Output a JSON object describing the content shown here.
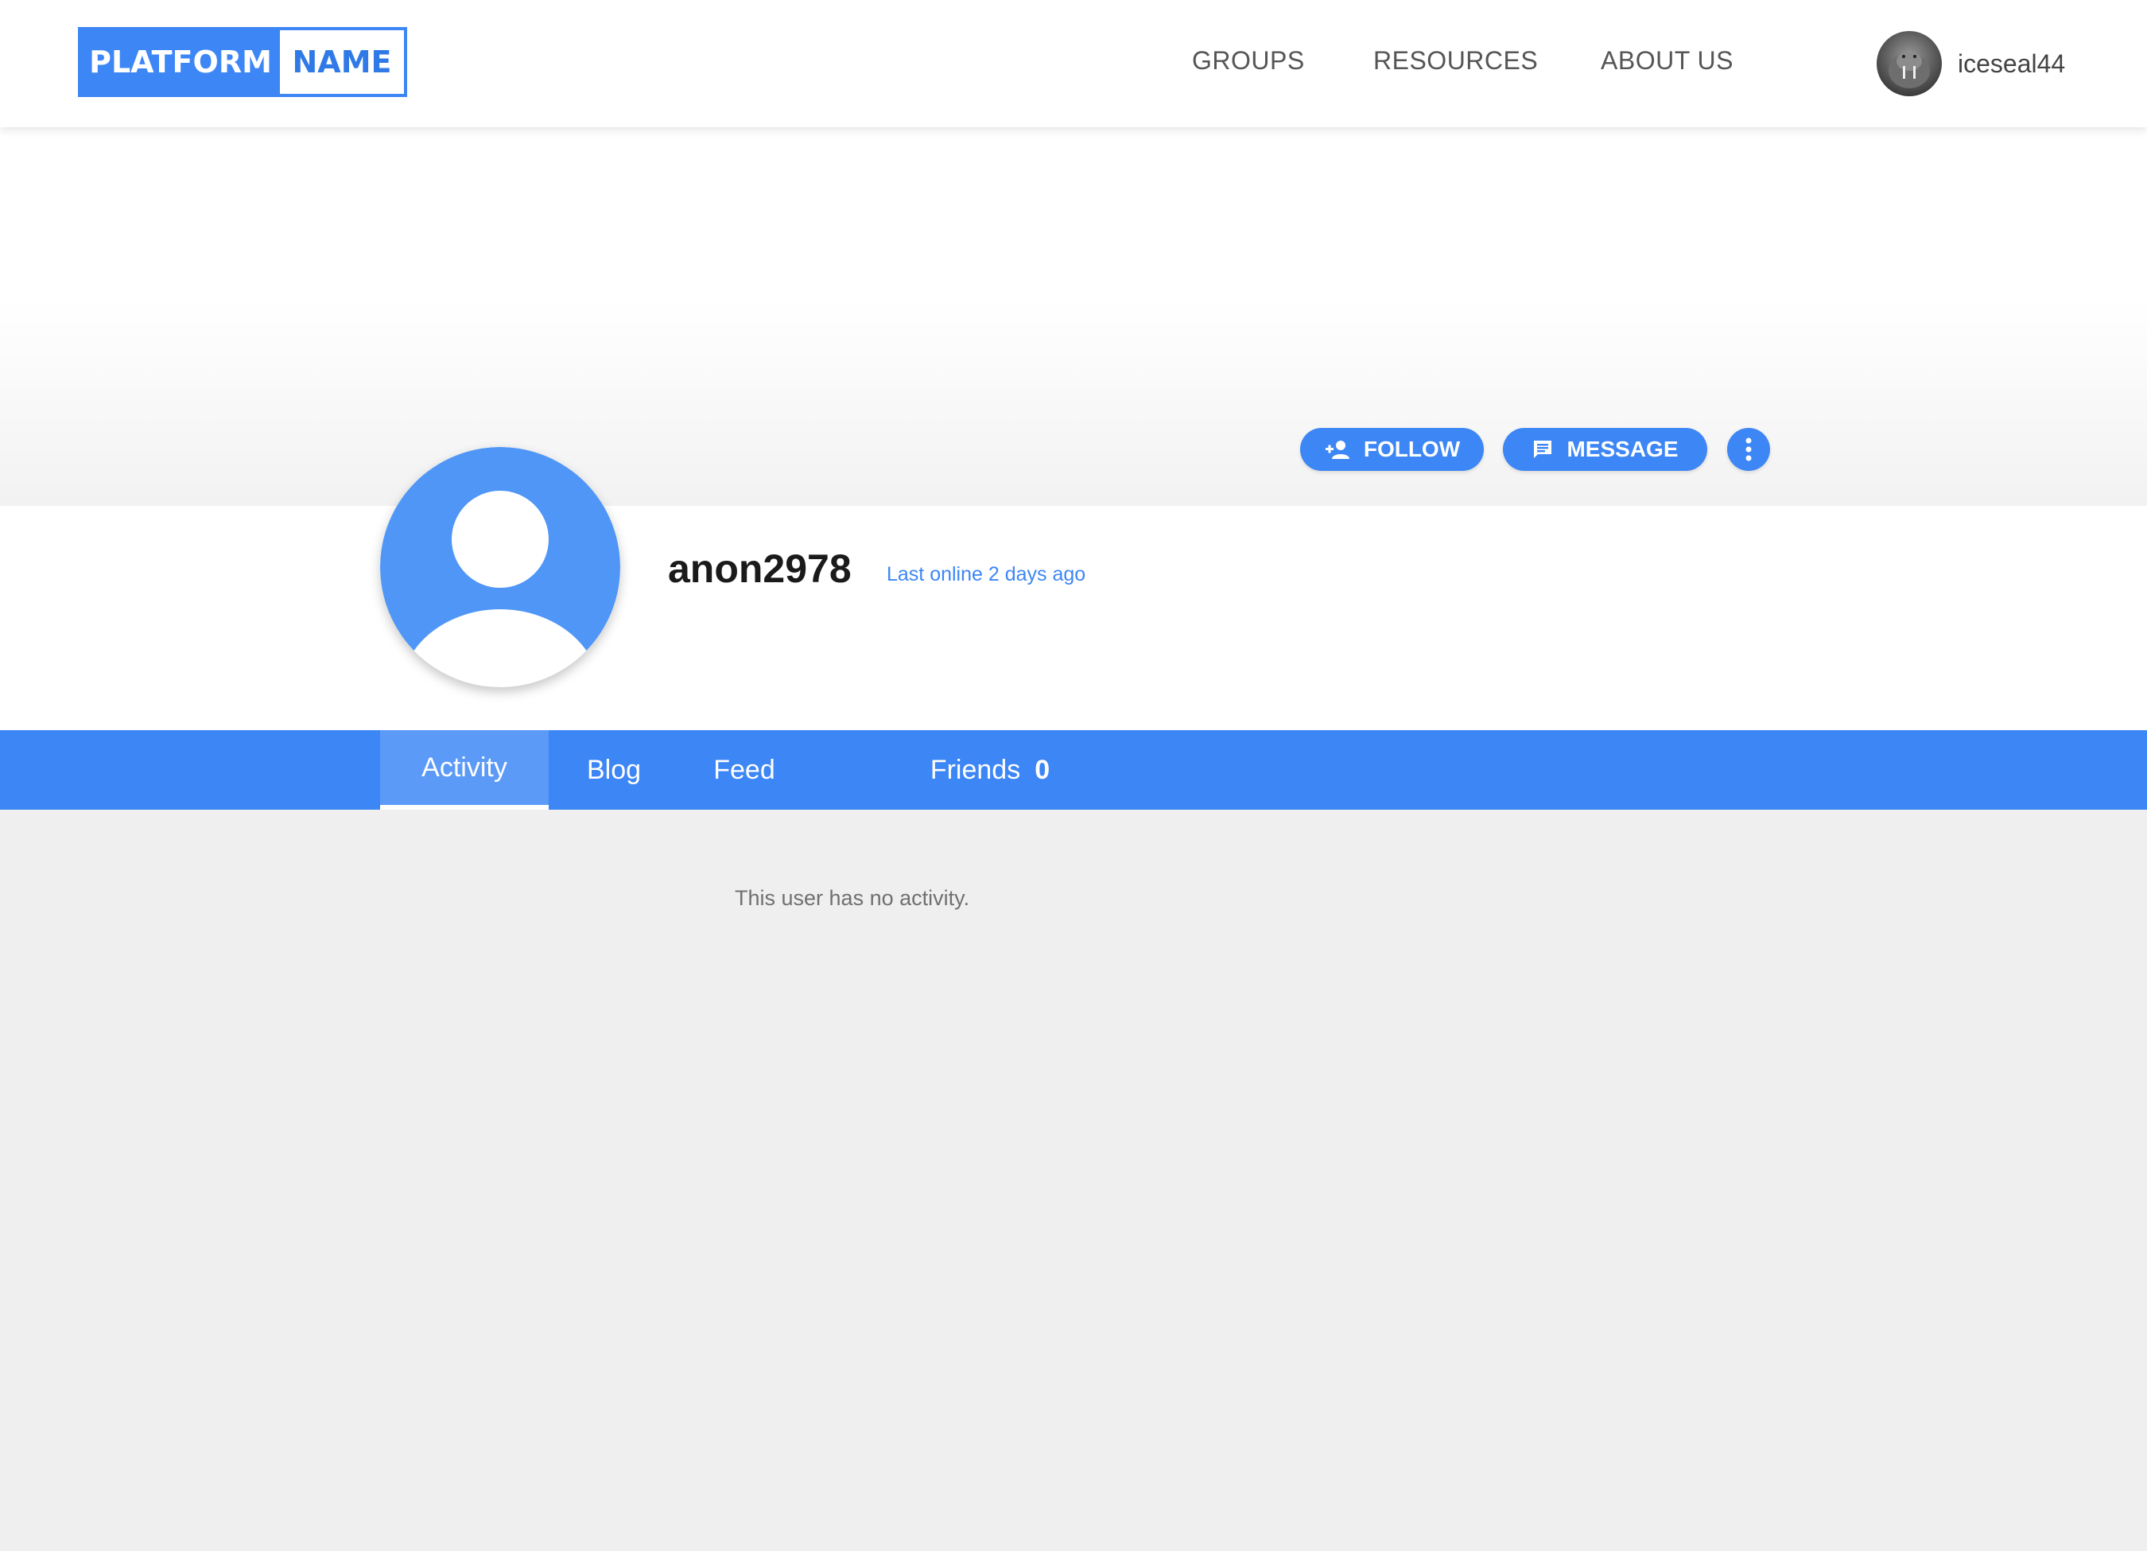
{
  "header": {
    "logo": {
      "left": "PLATFORM",
      "right": "NAME"
    },
    "nav": [
      "GROUPS",
      "RESOURCES",
      "ABOUT US"
    ],
    "user": {
      "name": "iceseal44"
    }
  },
  "profile": {
    "username": "anon2978",
    "last_online": "Last online 2 days ago",
    "actions": {
      "follow": "FOLLOW",
      "message": "MESSAGE"
    }
  },
  "tabs": {
    "activity": "Activity",
    "blog": "Blog",
    "feed": "Feed",
    "friends": "Friends",
    "friends_count": "0",
    "active": "Activity"
  },
  "content": {
    "empty_message": "This user has no activity."
  },
  "colors": {
    "accent": "#3d86f5",
    "tab_active_bg": "#5b9af7",
    "page_bg": "#efefef"
  }
}
